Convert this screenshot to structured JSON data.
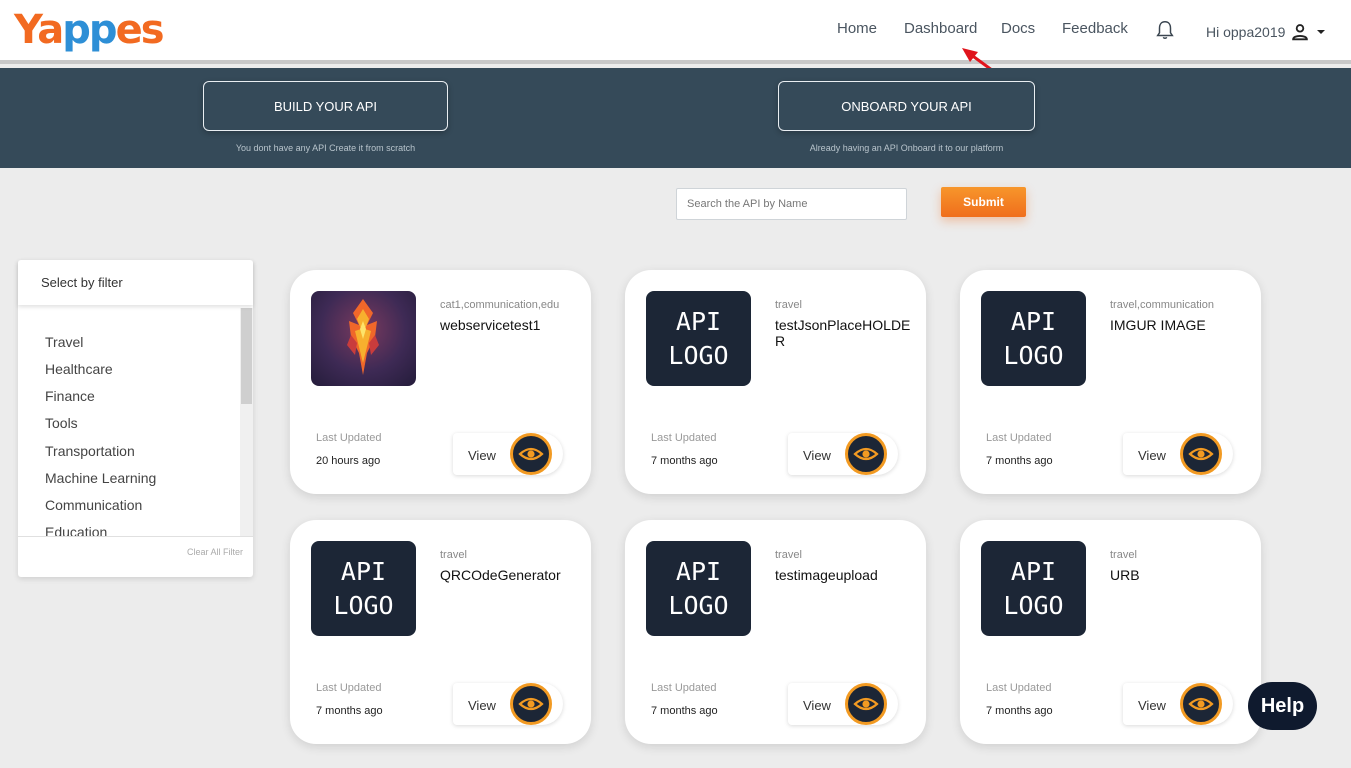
{
  "brand": {
    "logo_part1": "Ya",
    "logo_part2": "pp",
    "logo_part3": "es",
    "accent": "#f26a21",
    "logo_blue": "#2e8fd6"
  },
  "nav": {
    "items": [
      {
        "label": "Home"
      },
      {
        "label": "Dashboard"
      },
      {
        "label": "Docs"
      },
      {
        "label": "Feedback"
      }
    ],
    "bell_icon": "bell-icon",
    "user_label": "Hi oppa2019",
    "user_icon": "person-icon",
    "dropdown_icon": "caret-down-icon"
  },
  "banner": {
    "build_label": "BUILD YOUR API",
    "build_note": "You dont have any API Create it from scratch",
    "onboard_label": "ONBOARD YOUR API",
    "onboard_note": "Already having an API Onboard it to our platform",
    "background": "#354a59"
  },
  "search": {
    "placeholder": "Search the API by Name",
    "value": "",
    "submit_label": "Submit"
  },
  "filter": {
    "title": "Select by filter",
    "items": [
      "Travel",
      "Healthcare",
      "Finance",
      "Tools",
      "Transportation",
      "Machine Learning",
      "Communication",
      "Education"
    ],
    "clear_label": "Clear All Filter"
  },
  "cards": [
    {
      "thumb_type": "custom",
      "thumb_text": "",
      "category": "cat1,communication,edu",
      "name": "webservicetest1",
      "updated_label": "Last Updated",
      "updated": "20 hours ago",
      "view_label": "View"
    },
    {
      "thumb_type": "placeholder",
      "thumb_text": "API\nLOGO",
      "category": "travel",
      "name": "testJsonPlaceHOLDER",
      "updated_label": "Last Updated",
      "updated": "7 months ago",
      "view_label": "View"
    },
    {
      "thumb_type": "placeholder",
      "thumb_text": "API\nLOGO",
      "category": "travel,communication",
      "name": "IMGUR IMAGE",
      "updated_label": "Last Updated",
      "updated": "7 months ago",
      "view_label": "View"
    },
    {
      "thumb_type": "placeholder",
      "thumb_text": "API\nLOGO",
      "category": "travel",
      "name": "QRCOdeGenerator",
      "updated_label": "Last Updated",
      "updated": "7 months ago",
      "view_label": "View"
    },
    {
      "thumb_type": "placeholder",
      "thumb_text": "API\nLOGO",
      "category": "travel",
      "name": "testimageupload",
      "updated_label": "Last Updated",
      "updated": "7 months ago",
      "view_label": "View"
    },
    {
      "thumb_type": "placeholder",
      "thumb_text": "API\nLOGO",
      "category": "travel",
      "name": "URB",
      "updated_label": "Last Updated",
      "updated": "7 months ago",
      "view_label": "View"
    }
  ],
  "help_label": "Help",
  "eye_icon": "eye-icon"
}
